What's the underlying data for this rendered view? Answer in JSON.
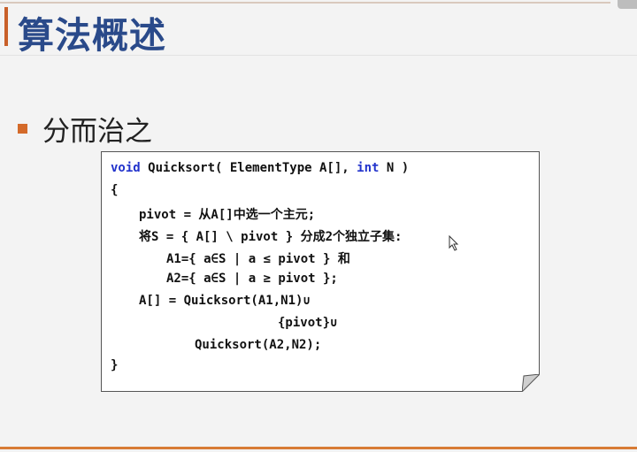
{
  "slide": {
    "title": "算法概述",
    "bullet": "分而治之"
  },
  "code": {
    "line1": {
      "kw1": "void",
      "text1": " Quicksort( ElementType A[], ",
      "kw2": "int",
      "text2": " N )"
    },
    "line2": "{",
    "line3": "pivot = 从A[]中选一个主元;",
    "line4": "将S = { A[] \\ pivot } 分成2个独立子集:",
    "line5": "A1={ a∈S | a ≤ pivot } 和",
    "line6": "A2={ a∈S | a ≥ pivot };",
    "line7": "A[] = Quicksort(A1,N1)∪",
    "line8": "{pivot}∪",
    "line9": "Quicksort(A2,N2);",
    "line10": "}"
  },
  "colors": {
    "accent": "#d46a2a",
    "title": "#2a4a8a",
    "keyword": "#2233cc"
  },
  "icons": {
    "bullet": "square-bullet-icon",
    "pointer": "mouse-cursor-icon"
  }
}
